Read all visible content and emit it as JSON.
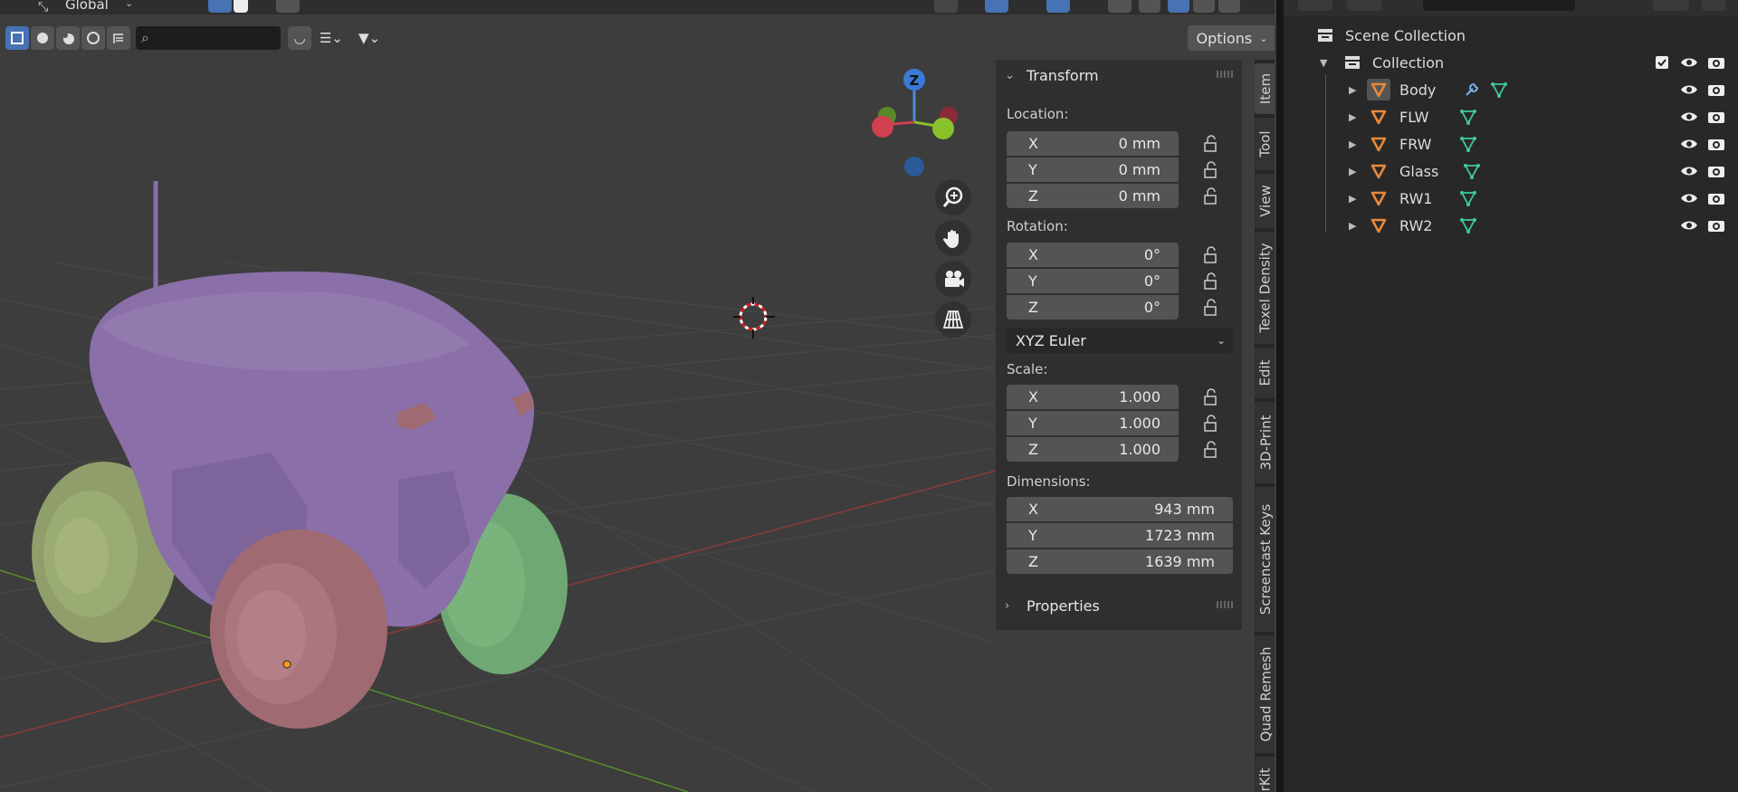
{
  "viewport": {
    "header": {
      "orientation_label": "Global",
      "search_placeholder": "",
      "options_label": "Options"
    },
    "gizmo": {
      "z_label": "Z"
    }
  },
  "npanel": {
    "transform": {
      "title": "Transform",
      "location_label": "Location:",
      "location": [
        {
          "axis": "X",
          "value": "0 mm"
        },
        {
          "axis": "Y",
          "value": "0 mm"
        },
        {
          "axis": "Z",
          "value": "0 mm"
        }
      ],
      "rotation_label": "Rotation:",
      "rotation": [
        {
          "axis": "X",
          "value": "0°"
        },
        {
          "axis": "Y",
          "value": "0°"
        },
        {
          "axis": "Z",
          "value": "0°"
        }
      ],
      "rotation_mode": "XYZ Euler",
      "scale_label": "Scale:",
      "scale": [
        {
          "axis": "X",
          "value": "1.000"
        },
        {
          "axis": "Y",
          "value": "1.000"
        },
        {
          "axis": "Z",
          "value": "1.000"
        }
      ],
      "dimensions_label": "Dimensions:",
      "dimensions": [
        {
          "axis": "X",
          "value": "943 mm"
        },
        {
          "axis": "Y",
          "value": "1723 mm"
        },
        {
          "axis": "Z",
          "value": "1639 mm"
        }
      ]
    },
    "properties": {
      "title": "Properties"
    },
    "tabs": [
      "Item",
      "Tool",
      "View",
      "Texel Density",
      "Edit",
      "3D-Print",
      "Screencast Keys",
      "Quad Remesh",
      "erKit"
    ]
  },
  "outliner": {
    "scene_collection": "Scene Collection",
    "collection": "Collection",
    "objects": [
      {
        "name": "Body",
        "has_modifier": true
      },
      {
        "name": "FLW",
        "has_modifier": false
      },
      {
        "name": "FRW",
        "has_modifier": false
      },
      {
        "name": "Glass",
        "has_modifier": false
      },
      {
        "name": "RW1",
        "has_modifier": false
      },
      {
        "name": "RW2",
        "has_modifier": false
      }
    ]
  },
  "colors": {
    "accent": "#4772b3",
    "object_orange": "#e8883a",
    "mesh_green": "#3fc9a0",
    "body_purple": "#8a6fa8",
    "wheel_pink": "#a06a72",
    "wheel_green": "#6fa872"
  }
}
